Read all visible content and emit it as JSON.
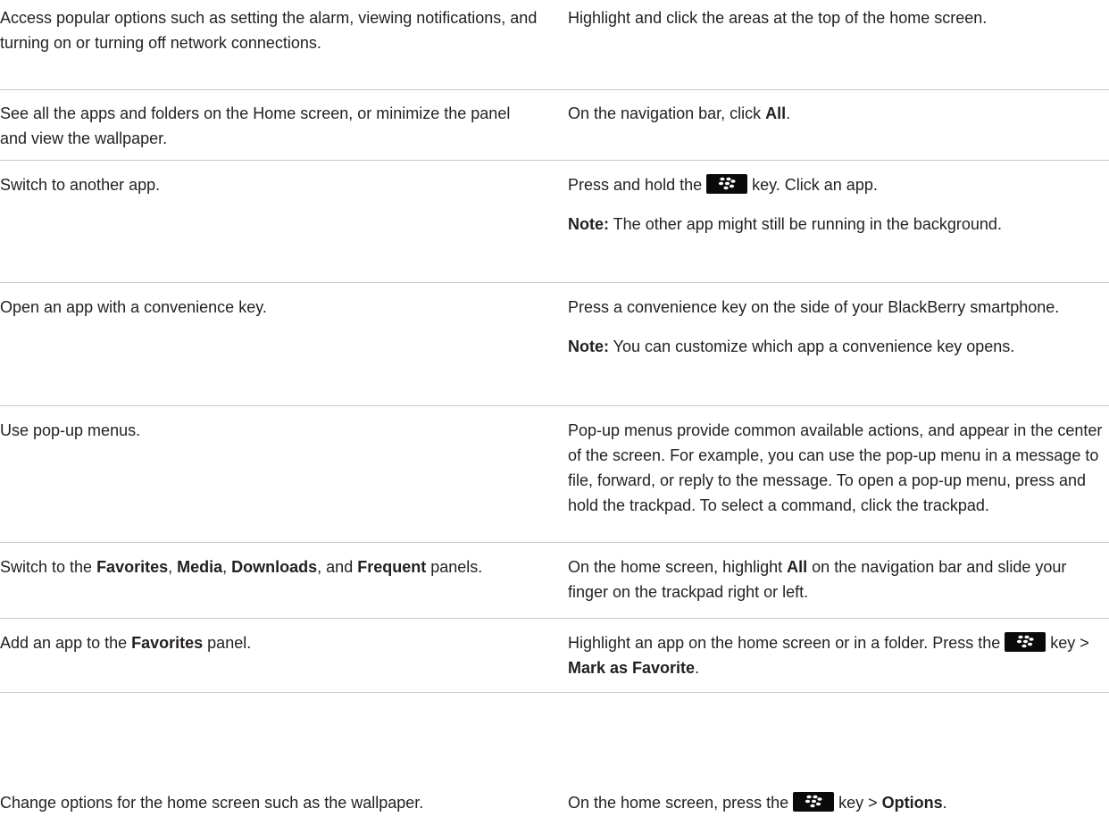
{
  "rows": [
    {
      "action": "Access popular options such as setting the alarm, viewing notifications, and turning on or turning off network connections.",
      "instruction": "Highlight and click the areas at the top of the home screen."
    },
    {
      "action": "See all the apps and folders on the Home screen, or minimize the panel and view the wallpaper.",
      "instruction_pre": "On the navigation bar, click ",
      "instruction_bold": "All",
      "instruction_post": "."
    },
    {
      "action": "Switch to another app.",
      "instruction_pre": "Press and hold the",
      "instruction_key_icon": "blackberry-menu-key-icon",
      "instruction_post": "key. Click an app.",
      "note_label": "Note:",
      "note_text": " The other app might still be running in the background."
    },
    {
      "action": "Open an app with a convenience key.",
      "instruction": "Press a convenience key on the side of your BlackBerry smartphone.",
      "note_label": "Note:",
      "note_text": " You can customize which app a convenience key opens."
    },
    {
      "action": "Use pop-up menus.",
      "instruction": "Pop-up menus provide common available actions, and appear in the center of the screen. For example, you can use the pop-up menu in a message to file, forward, or reply to the message. To open a pop-up menu, press and hold the trackpad. To select a command, click the trackpad."
    },
    {
      "action_pre": "Switch to the ",
      "action_b1": "Favorites",
      "action_s1": ", ",
      "action_b2": "Media",
      "action_s2": ", ",
      "action_b3": "Downloads",
      "action_s3": ", and ",
      "action_b4": "Frequent",
      "action_post": " panels.",
      "instruction_pre": "On the home screen, highlight ",
      "instruction_bold": "All",
      "instruction_post": " on the navigation bar and slide your finger on the trackpad right or left."
    },
    {
      "action_pre": "Add an app to the ",
      "action_bold": "Favorites",
      "action_post": " panel.",
      "instruction_pre": "Highlight an app on the home screen or in a folder. Press the",
      "instruction_key_icon": "blackberry-menu-key-icon",
      "instruction_mid": "key > ",
      "instruction_bold": "Mark as Favorite",
      "instruction_post": "."
    },
    {
      "action": "Change options for the home screen such as the wallpaper.",
      "instruction_pre": "On the home screen, press the",
      "instruction_key_icon": "blackberry-menu-key-icon",
      "instruction_mid": "key > ",
      "instruction_bold": "Options",
      "instruction_post": "."
    }
  ],
  "colors": {
    "text": "#231f20",
    "divider": "#c9c9c9",
    "key_background": "#0a0a0a",
    "key_glyph": "#ffffff"
  }
}
